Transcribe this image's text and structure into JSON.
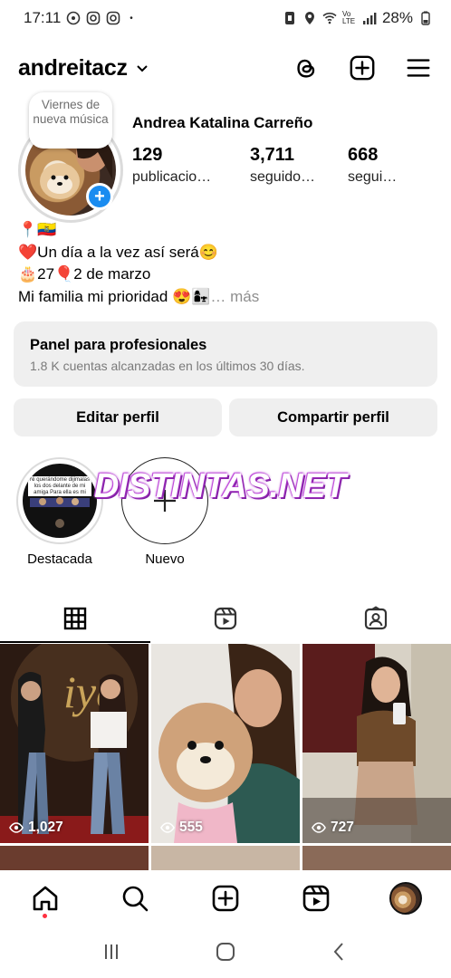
{
  "status_bar": {
    "time": "17:11",
    "battery": "28%",
    "network": "Vo LTE",
    "dot": "•"
  },
  "header": {
    "username": "andreitacz"
  },
  "profile": {
    "note": "Viernes de nueva música",
    "full_name": "Andrea Katalina Carreño",
    "stats": [
      {
        "number": "129",
        "label": "publicacio…"
      },
      {
        "number": "3,711",
        "label": "seguido…"
      },
      {
        "number": "668",
        "label": "segui…"
      }
    ],
    "bio": {
      "line1": "📍🇪🇨",
      "line2": "❤️Un día a la vez así será😊",
      "line3": "🎂27🎈2 de marzo",
      "line4": "Mi familia mi prioridad 😍👩‍👧",
      "more": "… más"
    }
  },
  "dashboard": {
    "title": "Panel para profesionales",
    "subtitle": "1.8 K cuentas alcanzadas en los últimos 30 días."
  },
  "buttons": {
    "edit": "Editar perfil",
    "share": "Compartir perfil"
  },
  "highlights": [
    {
      "label": "Destacada",
      "cover_text": "Ni querándome dijimalas los dos delante de mi amiga Para ella es mi dios"
    },
    {
      "label": "Nuevo"
    }
  ],
  "watermark": "DISTINTAS.NET",
  "posts": [
    {
      "views": "1,027",
      "colors": [
        "#3a2418",
        "#7a5a2a",
        "#c9a45a",
        "#1c2440"
      ]
    },
    {
      "views": "555",
      "colors": [
        "#e9e6e1",
        "#cfa27a",
        "#2d5a52",
        "#f2ede4"
      ]
    },
    {
      "views": "727",
      "colors": [
        "#5a1c1c",
        "#9c6a3f",
        "#d8d2c6",
        "#2b211c"
      ]
    }
  ],
  "colors": {
    "accent_blue": "#1a8cf0",
    "notification_red": "#ff3040",
    "watermark_purple": "#b43ccf"
  },
  "icons": {
    "header": [
      "threads-icon",
      "create-icon",
      "menu-icon"
    ],
    "tabs": [
      "grid-icon",
      "reels-icon",
      "tagged-icon"
    ],
    "nav": [
      "home-icon",
      "search-icon",
      "create-icon",
      "reels-icon",
      "profile-avatar"
    ]
  }
}
